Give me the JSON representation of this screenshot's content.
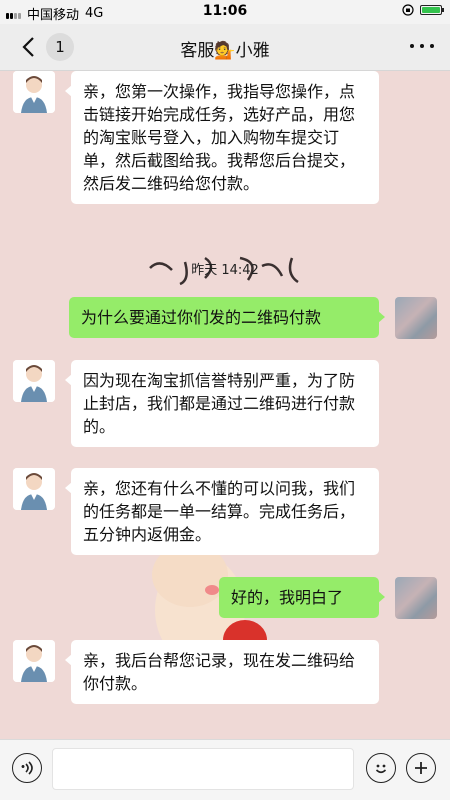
{
  "status_bar": {
    "carrier": "中国移动",
    "network": "4G",
    "time": "11:06"
  },
  "nav": {
    "back_count": "1",
    "title": "客服💁小雅",
    "icons": [
      "chevron-left-icon",
      "more-dots-icon"
    ]
  },
  "messages": [
    {
      "side": "in",
      "text": "亲，您第一次操作，我指导您操作，点击链接开始完成任务，选好产品，用您的淘宝账号登入，加入购物车提交订单，然后截图给我。我帮您后台提交，然后发二维码给您付款。"
    },
    {
      "type": "time",
      "text": "昨天 14:42"
    },
    {
      "side": "out",
      "text": "为什么要通过你们发的二维码付款"
    },
    {
      "side": "in",
      "text": "因为现在淘宝抓信誉特别严重，为了防止封店，我们都是通过二维码进行付款的。"
    },
    {
      "side": "in",
      "text": "亲，您还有什么不懂的可以问我，我们的任务都是一单一结算。完成任务后，五分钟内返佣金。"
    },
    {
      "side": "out",
      "text": "好的，我明白了"
    },
    {
      "side": "in",
      "text": "亲，我后台帮您记录，现在发二维码给你付款。"
    }
  ],
  "input_bar": {
    "icons": [
      "voice-icon",
      "emoji-icon",
      "plus-icon"
    ],
    "placeholder": ""
  },
  "colors": {
    "outgoing_bubble": "#95ec69",
    "incoming_bubble": "#ffffff",
    "chat_background": "#efd9d6"
  }
}
